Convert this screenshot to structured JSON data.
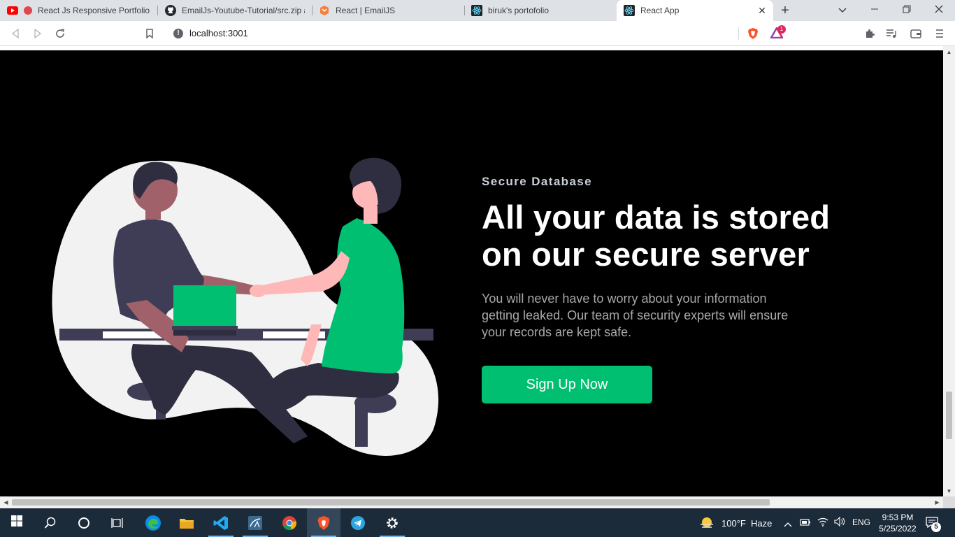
{
  "browser": {
    "tabs": [
      {
        "title": "React Js Responsive Portfolio w",
        "icon": "youtube-icon"
      },
      {
        "title": "EmailJs-Youtube-Tutorial/src.zip at",
        "icon": "github-icon"
      },
      {
        "title": "React | EmailJS",
        "icon": "emailjs-icon"
      },
      {
        "title": "biruk's portofolio",
        "icon": "react-icon"
      },
      {
        "title": "React App",
        "icon": "react-icon",
        "active": true
      }
    ],
    "url": "localhost:3001",
    "brave_rewards_badge": "1"
  },
  "hero": {
    "eyebrow": "Secure Database",
    "headline": "All your data is stored on our secure server",
    "description": "You will never have to worry about your information getting leaked. Our team of security experts will ensure your records are kept safe.",
    "cta_label": "Sign Up Now",
    "accent_color": "#01bf71"
  },
  "taskbar": {
    "weather_temp": "100°F",
    "weather_desc": "Haze",
    "language": "ENG",
    "time": "9:53 PM",
    "date": "5/25/2022",
    "notification_count": "5"
  }
}
